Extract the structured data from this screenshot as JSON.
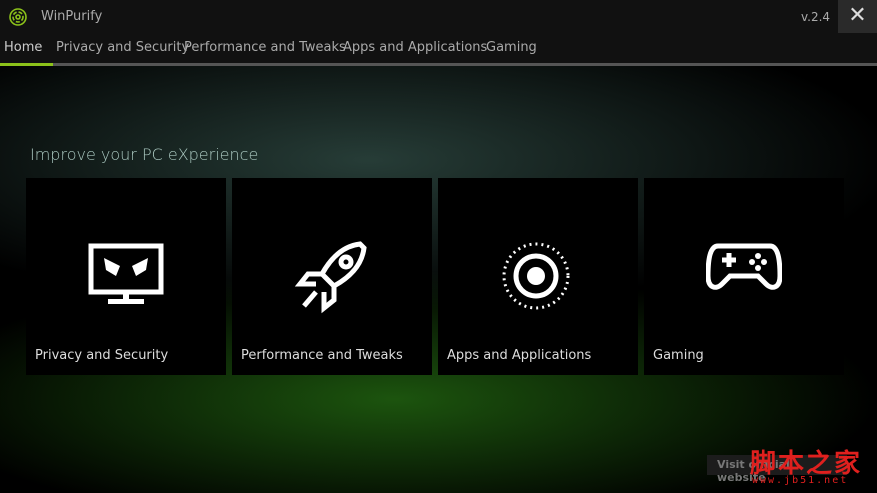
{
  "app": {
    "title": "WinPurify",
    "version": "v.2.4",
    "close": "✕"
  },
  "nav": {
    "tabs": [
      "Home",
      "Privacy and Security",
      "Performance and Tweaks",
      "Apps and Applications",
      "Gaming"
    ],
    "active": 0
  },
  "colors": {
    "accent": "#8cc21a"
  },
  "main": {
    "heading": "Improve your PC eXperience",
    "tiles": [
      {
        "label": "Privacy and Security",
        "icon": "monitor-mask-icon"
      },
      {
        "label": "Performance and Tweaks",
        "icon": "rocket-icon"
      },
      {
        "label": "Apps and Applications",
        "icon": "target-icon"
      },
      {
        "label": "Gaming",
        "icon": "gamepad-icon"
      }
    ],
    "visit": "Visit official website"
  },
  "watermark": {
    "cn": "脚本之家",
    "url": "www.jb51.net"
  }
}
